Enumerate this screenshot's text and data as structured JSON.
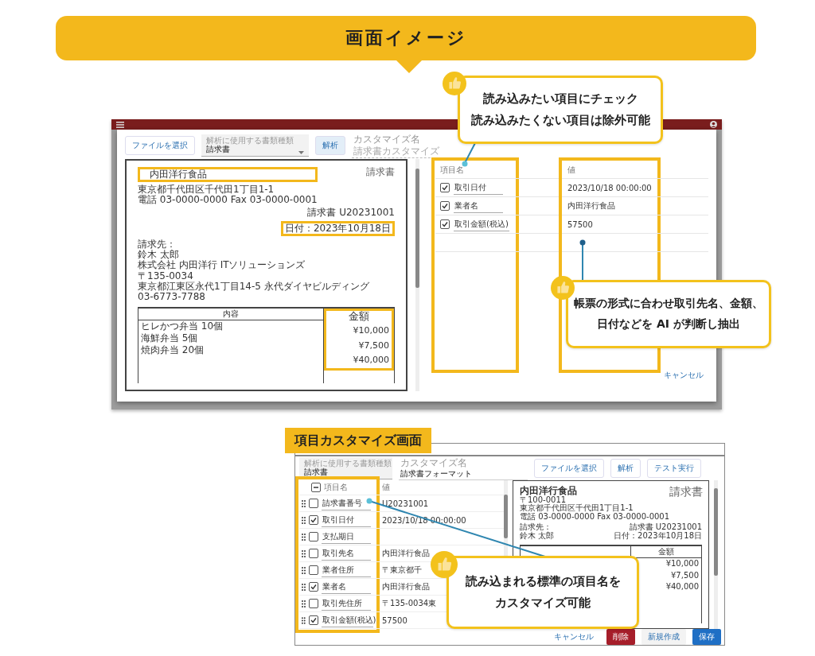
{
  "banner": {
    "title": "画面イメージ"
  },
  "screen1": {
    "toolbar": {
      "file_button": "ファイルを選択",
      "doc_type": {
        "label": "解析に使用する書類種類",
        "value": "請求書"
      },
      "analyze_button": "解析",
      "custom_name": {
        "label": "カスタマイズ名",
        "placeholder": "請求書カスタマイズ"
      }
    },
    "invoice": {
      "company": {
        "text": "内田洋行食品",
        "highlighted": true
      },
      "company_lines": [
        "東京都千代田区千代田1丁目1-1",
        "電話 03-0000-0000 Fax 03-0000-0001"
      ],
      "title": "請求書",
      "meta_lines": [
        "請求書 U20231001"
      ],
      "date": {
        "text": "日付：2023年10月18日",
        "highlighted": true
      },
      "bill_to": [
        "請求先：",
        "鈴木 太郎",
        "株式会社 内田洋行 ITソリューションズ",
        "〒135-0034",
        "東京都江東区永代1丁目14-5 永代ダイヤビルディング",
        "03-6773-7788"
      ],
      "table": {
        "item_header": "内容",
        "amount_header": "金額",
        "amount_highlighted": true,
        "items": [
          "ヒレかつ弁当 10個",
          "海鮮弁当 5個",
          "焼肉弁当 20個"
        ],
        "amounts": [
          "¥10,000",
          "¥7,500",
          "¥40,000"
        ]
      }
    },
    "fields": {
      "columns": [
        {
          "header": "項目名",
          "highlighted": true
        },
        {
          "header": "値",
          "highlighted": true
        }
      ],
      "rows": [
        {
          "name": "取引日付",
          "checked": true,
          "value": "2023/10/18 00:00:00"
        },
        {
          "name": "業者名",
          "checked": true,
          "value": "内田洋行食品"
        },
        {
          "name": "取引金額(税込)",
          "checked": true,
          "value": "57500"
        }
      ]
    },
    "cancel_button": "キャンセル"
  },
  "callouts": [
    {
      "lines": [
        "読み込みたい項目にチェック",
        "読み込みたくない項目は除外可能"
      ]
    },
    {
      "lines": [
        "帳票の形式に合わせ取引先名、金額、",
        "日付などを AI が判断し抽出"
      ]
    },
    {
      "lines": [
        "読み込まれる標準の項目名を",
        "カスタマイズ可能"
      ]
    }
  ],
  "section_label": "項目カスタマイズ画面",
  "screen2": {
    "toolbar": {
      "doc_type": {
        "label": "解析に使用する書類種類",
        "value": "請求書"
      },
      "custom_name": {
        "label": "カスタマイズ名",
        "value": "請求書フォーマット"
      },
      "buttons": [
        "ファイルを選択",
        "解析",
        "テスト実行"
      ]
    },
    "fields": {
      "highlighted": true,
      "header": {
        "label": "項目名",
        "indeterminate": true
      },
      "value_header": "値",
      "rows": [
        {
          "name": "請求書番号",
          "checked": false,
          "value": "U20231001"
        },
        {
          "name": "取引日付",
          "checked": true,
          "value": "2023/10/18 00:00:00"
        },
        {
          "name": "支払期日",
          "checked": false
        },
        {
          "name": "取引先名",
          "checked": false,
          "value": "内田洋行食品"
        },
        {
          "name": "業者住所",
          "checked": false,
          "value": "〒東京都千"
        },
        {
          "name": "業者名",
          "checked": true,
          "value": "内田洋行食品"
        },
        {
          "name": "取引先住所",
          "checked": false,
          "value": "〒135-0034東"
        },
        {
          "name": "取引金額(税込)",
          "checked": true,
          "value": "57500"
        }
      ]
    },
    "invoice": {
      "company": {
        "text": "内田洋行食品"
      },
      "company_lines": [
        "〒100-0011",
        "東京都千代田区千代田1丁目1-1",
        "電話 03-0000-0000 Fax 03-0000-0001"
      ],
      "title": "請求書",
      "meta_lines": [
        "請求書 U20231001",
        "日付：2023年10月18日"
      ],
      "bill_to": [
        "請求先：",
        "鈴木 太郎"
      ],
      "table": {
        "amount_header": "金額",
        "amount_highlighted": false,
        "amounts": [
          "¥10,000",
          "¥7,500",
          "¥40,000"
        ]
      }
    },
    "footer_buttons": [
      {
        "label": "キャンセル",
        "kind": "text"
      },
      {
        "label": "削除",
        "kind": "danger"
      },
      {
        "label": "新規作成",
        "kind": "plain"
      },
      {
        "label": "保存",
        "kind": "primary"
      }
    ]
  }
}
